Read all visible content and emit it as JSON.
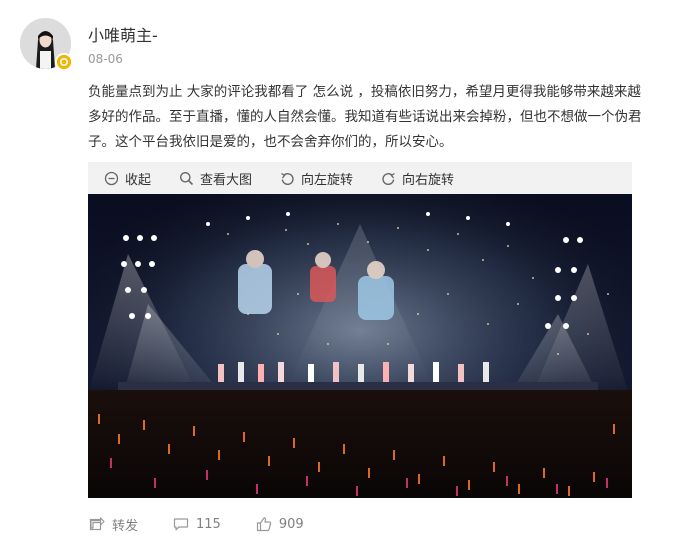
{
  "post": {
    "username": "小唯萌主-",
    "date": "08-06",
    "text": "负能量点到为止 大家的评论我都看了 怎么说 ，投稿依旧努力，希望月更得我能够带来越来越多好的作品。至于直播，懂的人自然会懂。我知道有些话说出来会掉粉，但也不想做一个伪君子。这个平台我依旧是爱的，也不会舍弃你们的，所以安心。"
  },
  "image_toolbar": {
    "collapse_label": "收起",
    "view_large_label": "查看大图",
    "rotate_left_label": "向左旋转",
    "rotate_right_label": "向右旋转"
  },
  "actions": {
    "repost_label": "转发",
    "comments_count": "115",
    "likes_count": "909"
  },
  "icons": {
    "avatar": "avatar",
    "badge": "verified-badge-icon",
    "collapse": "collapse-icon",
    "view_large": "search-icon",
    "rotate_left": "rotate-left-icon",
    "rotate_right": "rotate-right-icon",
    "repost": "repost-icon",
    "comment": "comment-icon",
    "like": "like-icon"
  },
  "colors": {
    "text": "#333333",
    "muted": "#999999",
    "toolbar_bg": "#f2f2f2",
    "badge": "#f5b400"
  }
}
